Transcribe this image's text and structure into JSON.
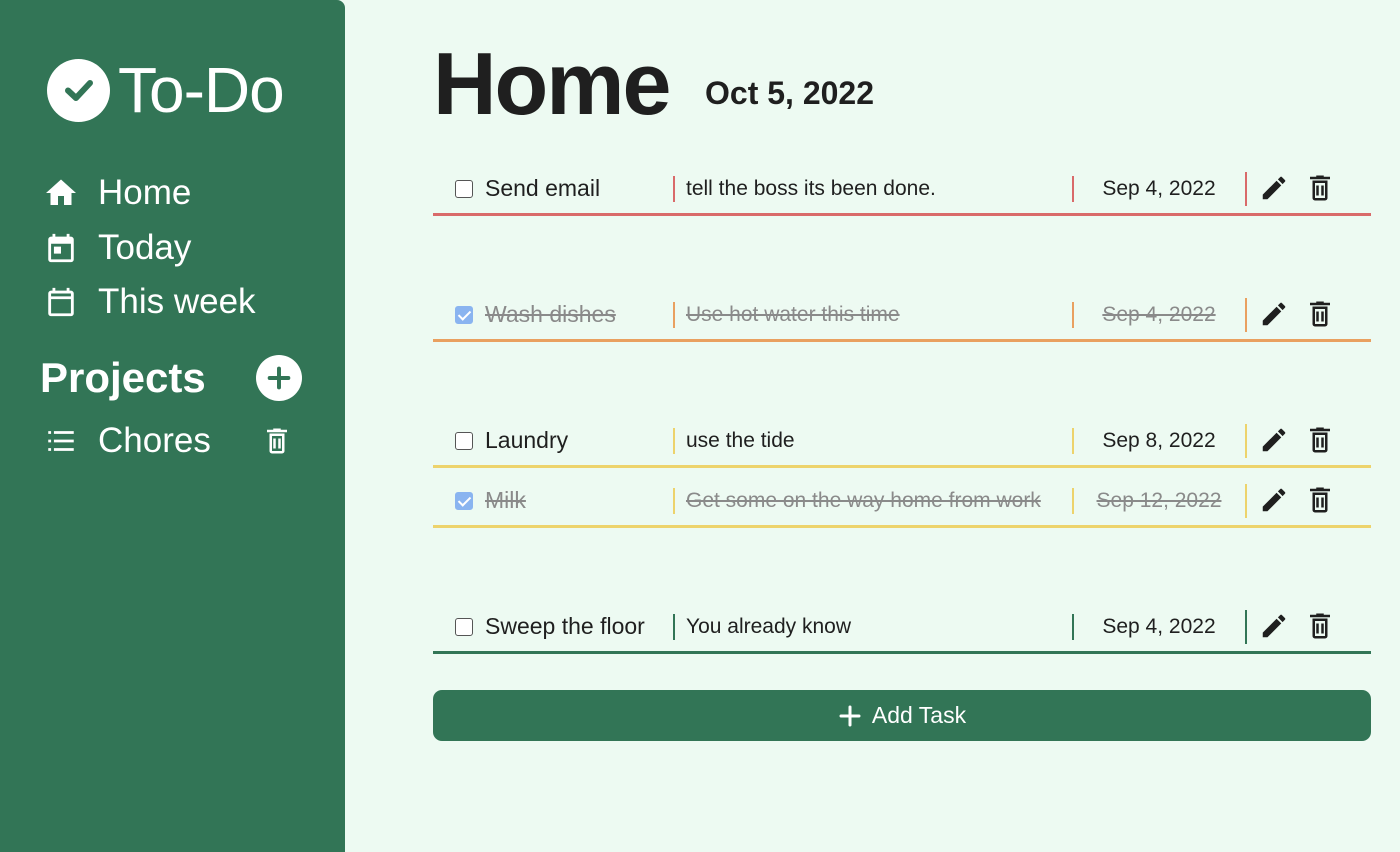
{
  "app": {
    "title": "To-Do"
  },
  "sidebar": {
    "nav": [
      {
        "label": "Home",
        "icon": "home-icon"
      },
      {
        "label": "Today",
        "icon": "calendar-day-icon"
      },
      {
        "label": "This week",
        "icon": "calendar-week-icon"
      }
    ],
    "projects_title": "Projects",
    "projects": [
      {
        "label": "Chores",
        "icon": "list-icon"
      }
    ]
  },
  "main": {
    "title": "Home",
    "date": "Oct 5, 2022",
    "tasks": [
      {
        "title": "Send email",
        "description": "tell the boss its been done.",
        "date": "Sep 4, 2022",
        "completed": false,
        "priority_color": "#d96a6a"
      },
      {
        "title": "Wash dishes",
        "description": "Use hot water this time",
        "date": "Sep 4, 2022",
        "completed": true,
        "priority_color": "#e9a060"
      },
      {
        "title": "Laundry",
        "description": "use the tide",
        "date": "Sep 8, 2022",
        "completed": false,
        "priority_color": "#edd36c"
      },
      {
        "title": "Milk",
        "description": "Get some on the way home from work",
        "date": "Sep 12, 2022",
        "completed": true,
        "priority_color": "#edd36c"
      },
      {
        "title": "Sweep the floor",
        "description": "You already know",
        "date": "Sep 4, 2022",
        "completed": false,
        "priority_color": "#327556"
      }
    ],
    "add_task_label": "Add Task"
  },
  "colors": {
    "sidebar_bg": "#327556",
    "page_bg": "#edfaf2",
    "checked": "#8ab4f0"
  }
}
